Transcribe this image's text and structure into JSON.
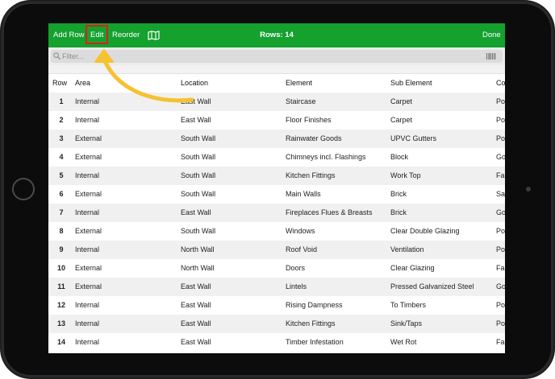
{
  "toolbar": {
    "add_row_label": "Add Row",
    "edit_label": "Edit",
    "reorder_label": "Reorder",
    "rows_label": "Rows: 14",
    "done_label": "Done",
    "map_icon": "map-icon"
  },
  "filter": {
    "placeholder": "Filter...",
    "search_icon": "search-icon",
    "barcode_icon": "barcode-icon"
  },
  "colors": {
    "toolbar": "#14a12e",
    "highlight_box": "#e21b1b",
    "arrow": "#f5c230"
  },
  "table": {
    "columns": [
      "Row",
      "Area",
      "Location",
      "Element",
      "Sub Element",
      "Co"
    ],
    "rows": [
      {
        "row": "1",
        "area": "Internal",
        "location": "East Wall",
        "element": "Staircase",
        "sub_element": "Carpet",
        "condition": "Po"
      },
      {
        "row": "2",
        "area": "Internal",
        "location": "East Wall",
        "element": "Floor Finishes",
        "sub_element": "Carpet",
        "condition": "Po"
      },
      {
        "row": "3",
        "area": "External",
        "location": "South Wall",
        "element": "Rainwater Goods",
        "sub_element": "UPVC Gutters",
        "condition": "Po"
      },
      {
        "row": "4",
        "area": "External",
        "location": "South Wall",
        "element": "Chimneys incl. Flashings",
        "sub_element": "Block",
        "condition": "Go"
      },
      {
        "row": "5",
        "area": "Internal",
        "location": "South Wall",
        "element": "Kitchen Fittings",
        "sub_element": "Work Top",
        "condition": "Fai"
      },
      {
        "row": "6",
        "area": "External",
        "location": "South Wall",
        "element": "Main Walls",
        "sub_element": "Brick",
        "condition": "Sa"
      },
      {
        "row": "7",
        "area": "Internal",
        "location": "East Wall",
        "element": "Fireplaces Flues & Breasts",
        "sub_element": "Brick",
        "condition": "Go"
      },
      {
        "row": "8",
        "area": "External",
        "location": "South Wall",
        "element": "Windows",
        "sub_element": "Clear Double Glazing",
        "condition": "Po"
      },
      {
        "row": "9",
        "area": "Internal",
        "location": "North Wall",
        "element": "Roof Void",
        "sub_element": "Ventilation",
        "condition": "Po"
      },
      {
        "row": "10",
        "area": "External",
        "location": "North Wall",
        "element": "Doors",
        "sub_element": "Clear Glazing",
        "condition": "Fai"
      },
      {
        "row": "11",
        "area": "External",
        "location": "East Wall",
        "element": "Lintels",
        "sub_element": "Pressed Galvanized Steel",
        "condition": "Go"
      },
      {
        "row": "12",
        "area": "Internal",
        "location": "East Wall",
        "element": "Rising Dampness",
        "sub_element": "To Timbers",
        "condition": "Po"
      },
      {
        "row": "13",
        "area": "Internal",
        "location": "East Wall",
        "element": "Kitchen Fittings",
        "sub_element": "Sink/Taps",
        "condition": "Po"
      },
      {
        "row": "14",
        "area": "Internal",
        "location": "East Wall",
        "element": "Timber Infestation",
        "sub_element": "Wet Rot",
        "condition": "Fai"
      }
    ]
  }
}
